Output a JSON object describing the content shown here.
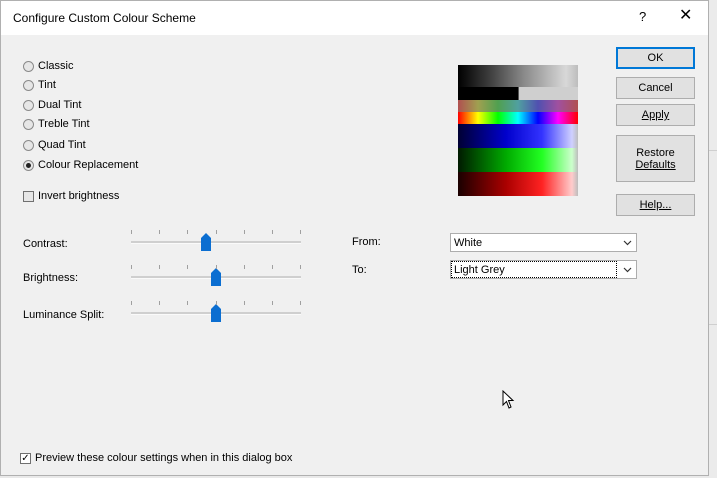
{
  "window": {
    "title": "Configure Custom Colour Scheme",
    "help_glyph": "?",
    "close_glyph": "✕"
  },
  "scheme_options": [
    {
      "label": "Classic",
      "selected": false
    },
    {
      "label": "Tint",
      "selected": false
    },
    {
      "label": "Dual Tint",
      "selected": false
    },
    {
      "label": "Treble Tint",
      "selected": false
    },
    {
      "label": "Quad Tint",
      "selected": false
    },
    {
      "label": "Colour Replacement",
      "selected": true
    }
  ],
  "invert_brightness": {
    "label": "Invert brightness",
    "checked": false
  },
  "sliders": [
    {
      "label": "Contrast:",
      "level_fraction": 0.44
    },
    {
      "label": "Brightness:",
      "level_fraction": 0.5
    },
    {
      "label": "Luminance Split:",
      "level_fraction": 0.5
    }
  ],
  "replacement": {
    "from_label": "From:",
    "from_value": "White",
    "to_label": "To:",
    "to_value": "Light Grey"
  },
  "buttons": {
    "ok": "OK",
    "cancel": "Cancel",
    "apply": "Apply",
    "restore_line1": "Restore",
    "restore_line2": "Defaults",
    "help": "Help..."
  },
  "preview_checkbox": {
    "label": "Preview these colour settings when in this dialog box",
    "checked": true
  },
  "colors": {
    "accent": "#0078d7",
    "slider_thumb": "#0b6ed1",
    "dialog_bg": "#f0f0f0"
  }
}
